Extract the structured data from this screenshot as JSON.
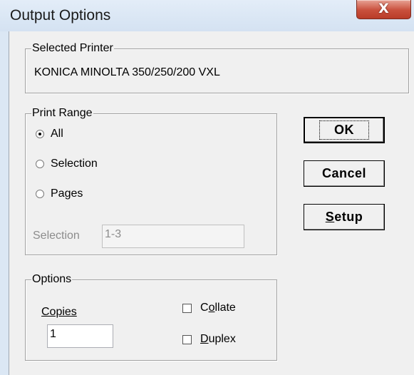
{
  "window": {
    "title": "Output Options",
    "close_glyph": "X"
  },
  "selected_printer": {
    "legend": "Selected Printer",
    "name": "KONICA MINOLTA 350/250/200 VXL"
  },
  "print_range": {
    "legend": "Print Range",
    "options": [
      {
        "label": "All",
        "checked": true
      },
      {
        "label": "Selection",
        "checked": false
      },
      {
        "label": "Pages",
        "checked": false
      }
    ],
    "selection_label": "Selection",
    "selection_value": "1-3"
  },
  "options": {
    "legend": "Options",
    "copies_label": "Copies",
    "copies_value": "1",
    "collate": {
      "prefix": "C",
      "accel": "o",
      "rest": "llate",
      "checked": false
    },
    "duplex": {
      "accel": "D",
      "rest": "uplex",
      "checked": false
    }
  },
  "buttons": {
    "ok": "OK",
    "cancel": "Cancel",
    "setup_accel": "S",
    "setup_rest": "etup"
  },
  "colors": {
    "title_bar": "#dbe7f4",
    "close_button": "#c9503c",
    "dialog_face": "#f0f0f0"
  }
}
